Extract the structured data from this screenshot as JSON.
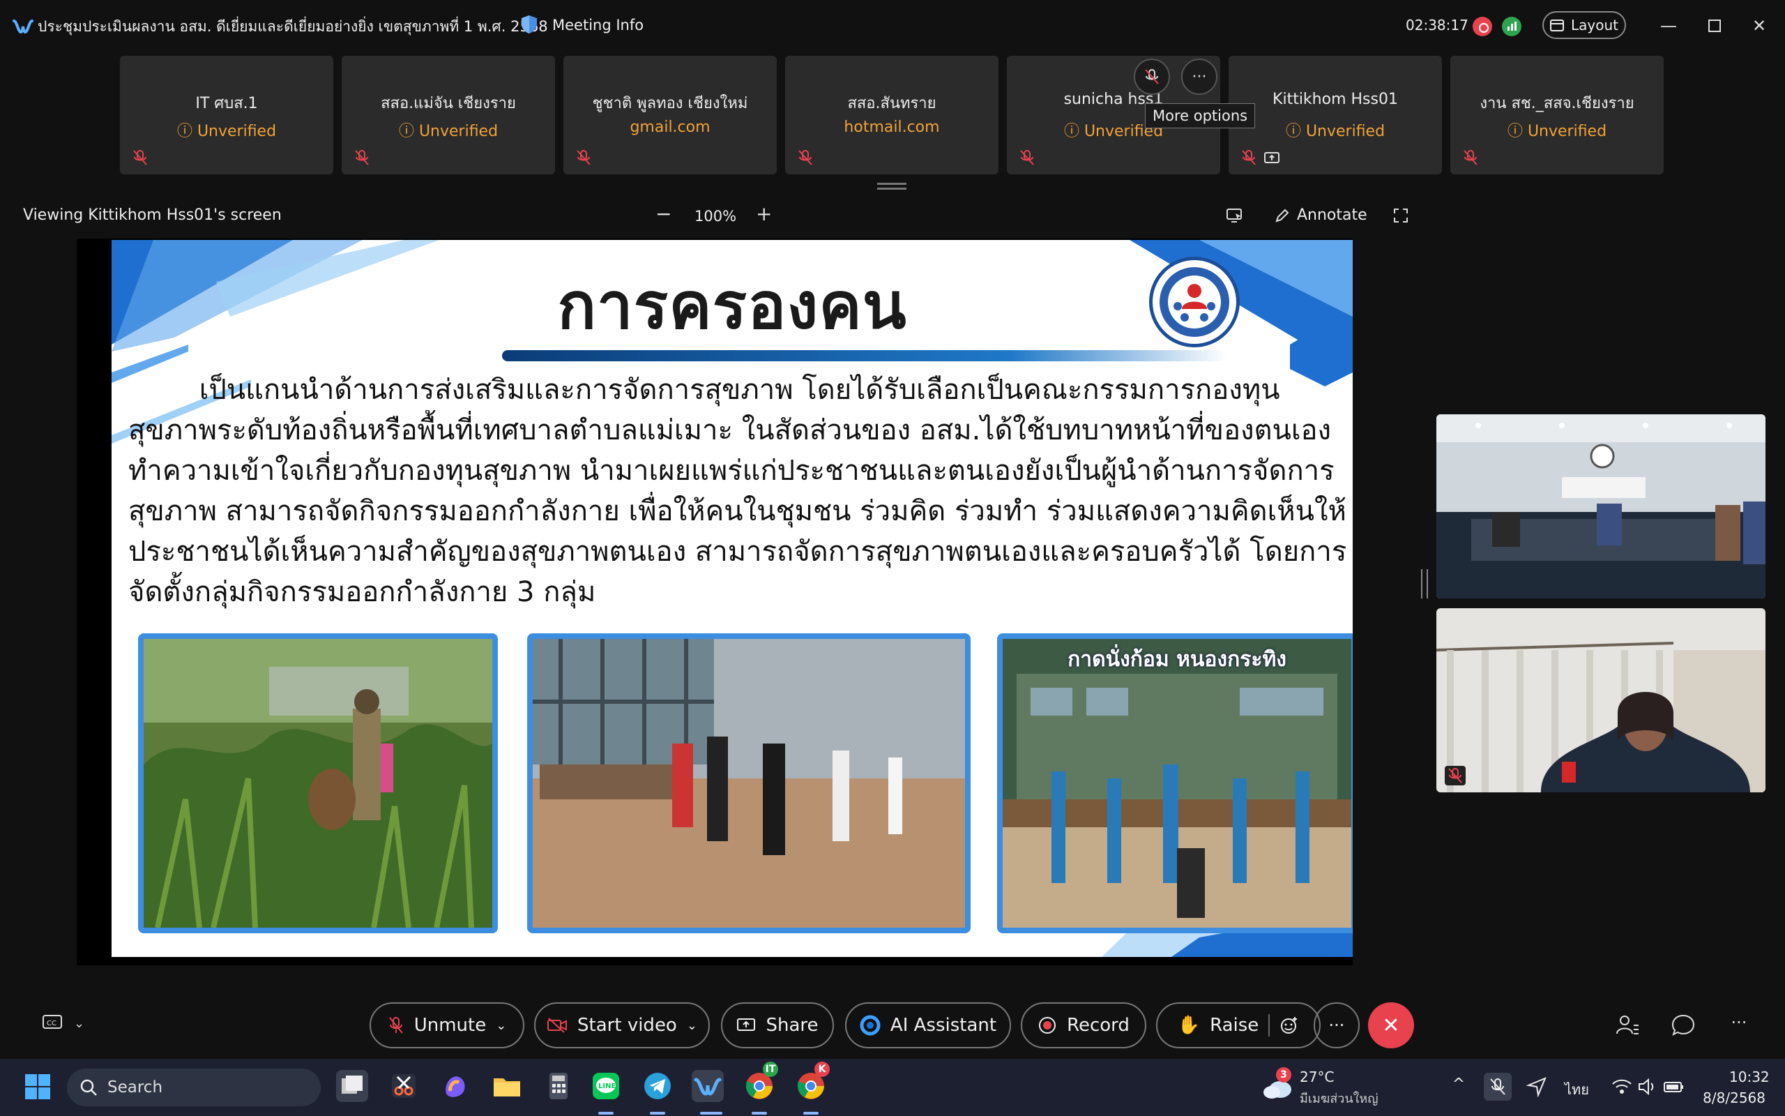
{
  "titlebar": {
    "meeting_title": "ประชุมประเมินผลงาน อสม. ดีเยี่ยมและดีเยี่ยมอย่างยิ่ง เขตสุขภาพที่ 1 พ.ศ. 2568",
    "meeting_info": "Meeting Info",
    "timer": "02:38:17",
    "layout_label": "Layout"
  },
  "participants": [
    {
      "name": "IT ศบส.1",
      "sub": "Unverified"
    },
    {
      "name": "สสอ.แม่จัน เชียงราย",
      "sub": "Unverified"
    },
    {
      "name": "ชูชาติ พูลทอง เชียงใหม่",
      "sub": "gmail.com"
    },
    {
      "name": "สสอ.สันทราย",
      "sub": "hotmail.com"
    },
    {
      "name": "sunicha hss1",
      "sub": "Unverified"
    },
    {
      "name": "Kittikhom Hss01",
      "sub": "Unverified"
    },
    {
      "name": "งาน สช._สสจ.เชียงราย",
      "sub": "Unverified"
    }
  ],
  "tooltip": "More options",
  "share_header": {
    "viewing": "Viewing Kittikhom Hss01's screen",
    "zoom": "100%",
    "annotate": "Annotate"
  },
  "slide": {
    "title": "การครองคน",
    "lines": [
      "        เป็นแกนนำด้านการส่งเสริมและการจัดการสุขภาพ โดยได้รับเลือกเป็นคณะกรรมการกองทุน",
      "สุขภาพระดับท้องถิ่นหรือพื้นที่เทศบาลตำบลแม่เมาะ ในสัดส่วนของ อสม.ได้ใช้บทบาทหน้าที่ของตนเอง",
      "ทำความเข้าใจเกี่ยวกับกองทุนสุขภาพ นำมาเผยแพร่แก่ประชาชนและตนเองยังเป็นผู้นำด้านการจัดการ",
      "สุขภาพ สามารถจัดกิจกรรมออกกำลังกาย เพื่อให้คนในชุมชน ร่วมคิด ร่วมทำ ร่วมแสดงความคิดเห็นให้",
      "ประชาชนได้เห็นความสำคัญของสุขภาพตนเอง สามารถจัดการสุขภาพตนเองและครอบครัวได้ โดยการ",
      "จัดตั้งกลุ่มกิจกรรมออกกำลังกาย 3 กลุ่ม"
    ],
    "photo3_label": "กาดนั่งก้อม หนองกระทิง"
  },
  "controls": {
    "unmute": "Unmute",
    "start_video": "Start video",
    "share": "Share",
    "ai_assistant": "AI Assistant",
    "record": "Record",
    "raise": "Raise"
  },
  "taskbar": {
    "search": "Search",
    "weather_temp": "27°C",
    "weather_loc": "มีเมฆส่วนใหญ่",
    "weather_badge": "3",
    "lang": "ไทย",
    "time": "10:32",
    "date": "8/8/2568",
    "chrome1_badge": "IT",
    "chrome2_badge": "K"
  },
  "colors": {
    "unverified": "#f0a33a",
    "leave": "#e8424f",
    "slide_accent": "#1f78c8"
  }
}
